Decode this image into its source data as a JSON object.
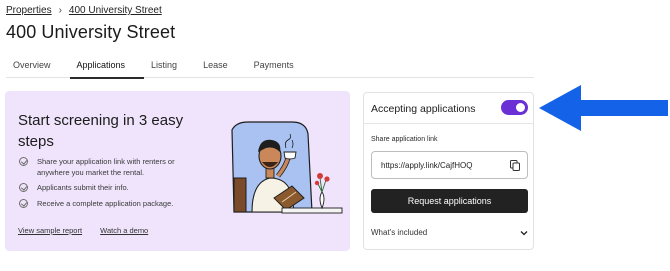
{
  "breadcrumb": {
    "root": "Properties",
    "separator": "›",
    "current": "400 University Street"
  },
  "page": {
    "title": "400 University Street"
  },
  "tabs": [
    {
      "label": "Overview",
      "active": false
    },
    {
      "label": "Applications",
      "active": true
    },
    {
      "label": "Listing",
      "active": false
    },
    {
      "label": "Lease",
      "active": false
    },
    {
      "label": "Payments",
      "active": false
    }
  ],
  "promo": {
    "title": "Start screening in 3 easy steps",
    "steps": [
      "Share your application link with renters or anywhere you market the rental.",
      "Applicants submit their info.",
      "Receive a complete application package."
    ],
    "link_sample": "View sample report",
    "link_demo": "Watch a demo"
  },
  "applications": {
    "heading": "Accepting applications",
    "accepting_enabled": true,
    "share_label": "Share application link",
    "share_link": "https://apply.link/CajfHOQ",
    "request_button": "Request applications",
    "whats_included": "What's included"
  },
  "colors": {
    "toggle_on": "#6b2fd6",
    "promo_bg": "#efe4fb",
    "arrow": "#1462e8",
    "button_bg": "#222222"
  },
  "icons": {
    "breadcrumb_sep": "chevron-right-icon",
    "copy": "copy-icon",
    "included_toggle": "chevron-down-icon",
    "step": "check-circle-icon"
  }
}
